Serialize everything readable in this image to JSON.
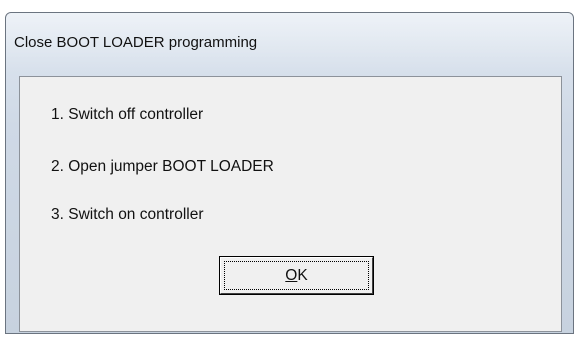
{
  "dialog": {
    "title": "Close BOOT LOADER programming",
    "instructions": [
      "1. Switch off controller",
      "2. Open jumper BOOT LOADER",
      "3. Switch on controller"
    ],
    "ok_button": {
      "mnemonic": "O",
      "rest": "K"
    }
  }
}
